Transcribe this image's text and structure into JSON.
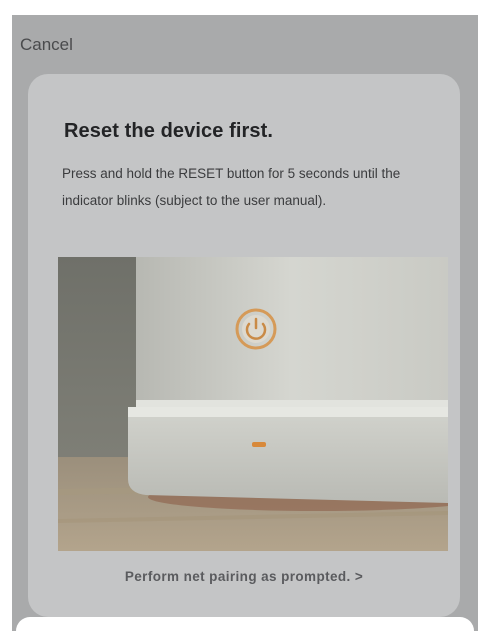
{
  "header": {
    "cancel_label": "Cancel"
  },
  "card": {
    "title": "Reset the device first.",
    "description": "Press and hold the RESET button for 5 seconds until the indicator blinks (subject to the user manual).",
    "link_label": "Perform net pairing as prompted. >"
  },
  "colors": {
    "overlay": "#a9aaab",
    "card_background": "#c4c5c6",
    "indicator_light": "#d8893a",
    "title_text": "#232426"
  }
}
